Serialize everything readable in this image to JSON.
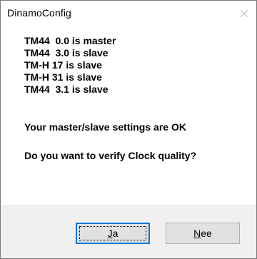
{
  "window": {
    "title": "DinamoConfig",
    "close_icon": "close-icon"
  },
  "message": {
    "lines": [
      "TM44  0.0 is master",
      "TM44  3.0 is slave",
      "TM-H 17 is slave",
      "TM-H 31 is slave",
      "TM44  3.1 is slave"
    ],
    "status": "Your master/slave settings are OK",
    "question": "Do you want to verify Clock quality?"
  },
  "buttons": {
    "yes": {
      "accel": "J",
      "rest": "a",
      "label": "Ja",
      "is_default": true
    },
    "no": {
      "accel": "N",
      "rest": "ee",
      "label": "Nee",
      "is_default": false
    }
  },
  "colors": {
    "focus_border": "#0078d7",
    "button_face": "#e1e1e1",
    "dialog_bg": "#f0f0f0"
  }
}
